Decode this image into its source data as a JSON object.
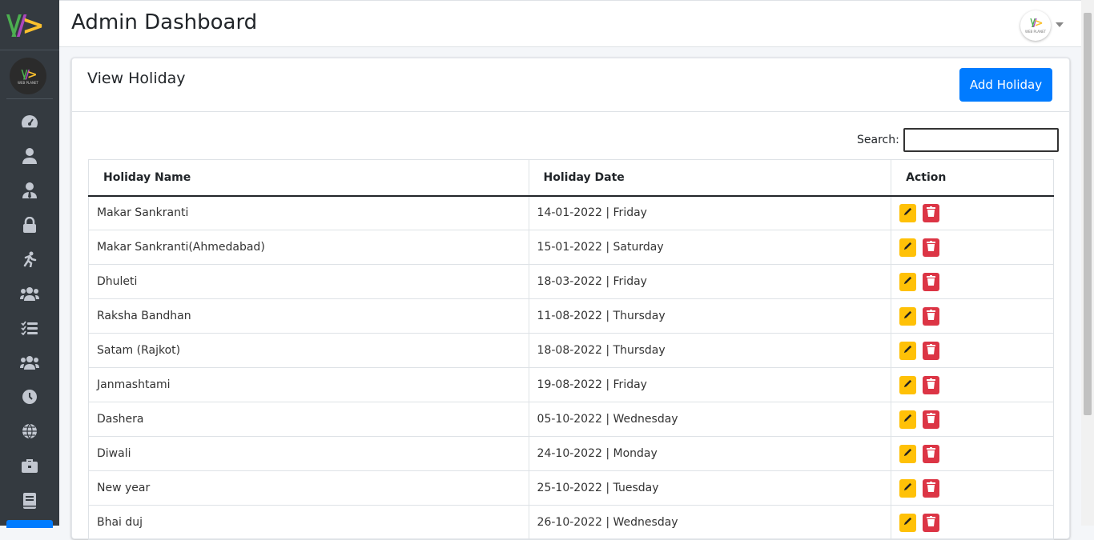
{
  "header": {
    "title": "Admin Dashboard"
  },
  "brand": {
    "logo_text": "WEB PLANET"
  },
  "sidebar": {
    "items": [
      {
        "icon": "dashboard-icon"
      },
      {
        "icon": "user-icon"
      },
      {
        "icon": "user-tie-icon"
      },
      {
        "icon": "lock-icon"
      },
      {
        "icon": "running-icon"
      },
      {
        "icon": "users-icon"
      },
      {
        "icon": "list-icon"
      },
      {
        "icon": "group-icon"
      },
      {
        "icon": "clock-icon"
      },
      {
        "icon": "globe-icon"
      },
      {
        "icon": "briefcase-icon"
      },
      {
        "icon": "book-icon"
      }
    ]
  },
  "page": {
    "title": "View Holiday",
    "add_button": "Add Holiday",
    "search_label": "Search:",
    "search_value": ""
  },
  "table": {
    "columns": [
      "Holiday Name",
      "Holiday Date",
      "Action"
    ],
    "rows": [
      {
        "name": "Makar Sankranti",
        "date": "14-01-2022 | Friday"
      },
      {
        "name": "Makar Sankranti(Ahmedabad)",
        "date": "15-01-2022 | Saturday"
      },
      {
        "name": "Dhuleti",
        "date": "18-03-2022 | Friday"
      },
      {
        "name": "Raksha Bandhan",
        "date": "11-08-2022 | Thursday"
      },
      {
        "name": "Satam (Rajkot)",
        "date": "18-08-2022 | Thursday"
      },
      {
        "name": "Janmashtami",
        "date": "19-08-2022 | Friday"
      },
      {
        "name": "Dashera",
        "date": "05-10-2022 | Wednesday"
      },
      {
        "name": "Diwali",
        "date": "24-10-2022 | Monday"
      },
      {
        "name": "New year",
        "date": "25-10-2022 | Tuesday"
      },
      {
        "name": "Bhai duj",
        "date": "26-10-2022 | Wednesday"
      }
    ]
  },
  "colors": {
    "sidebar": "#343a40",
    "primary": "#007bff",
    "edit": "#ffc107",
    "delete": "#dc3545"
  }
}
